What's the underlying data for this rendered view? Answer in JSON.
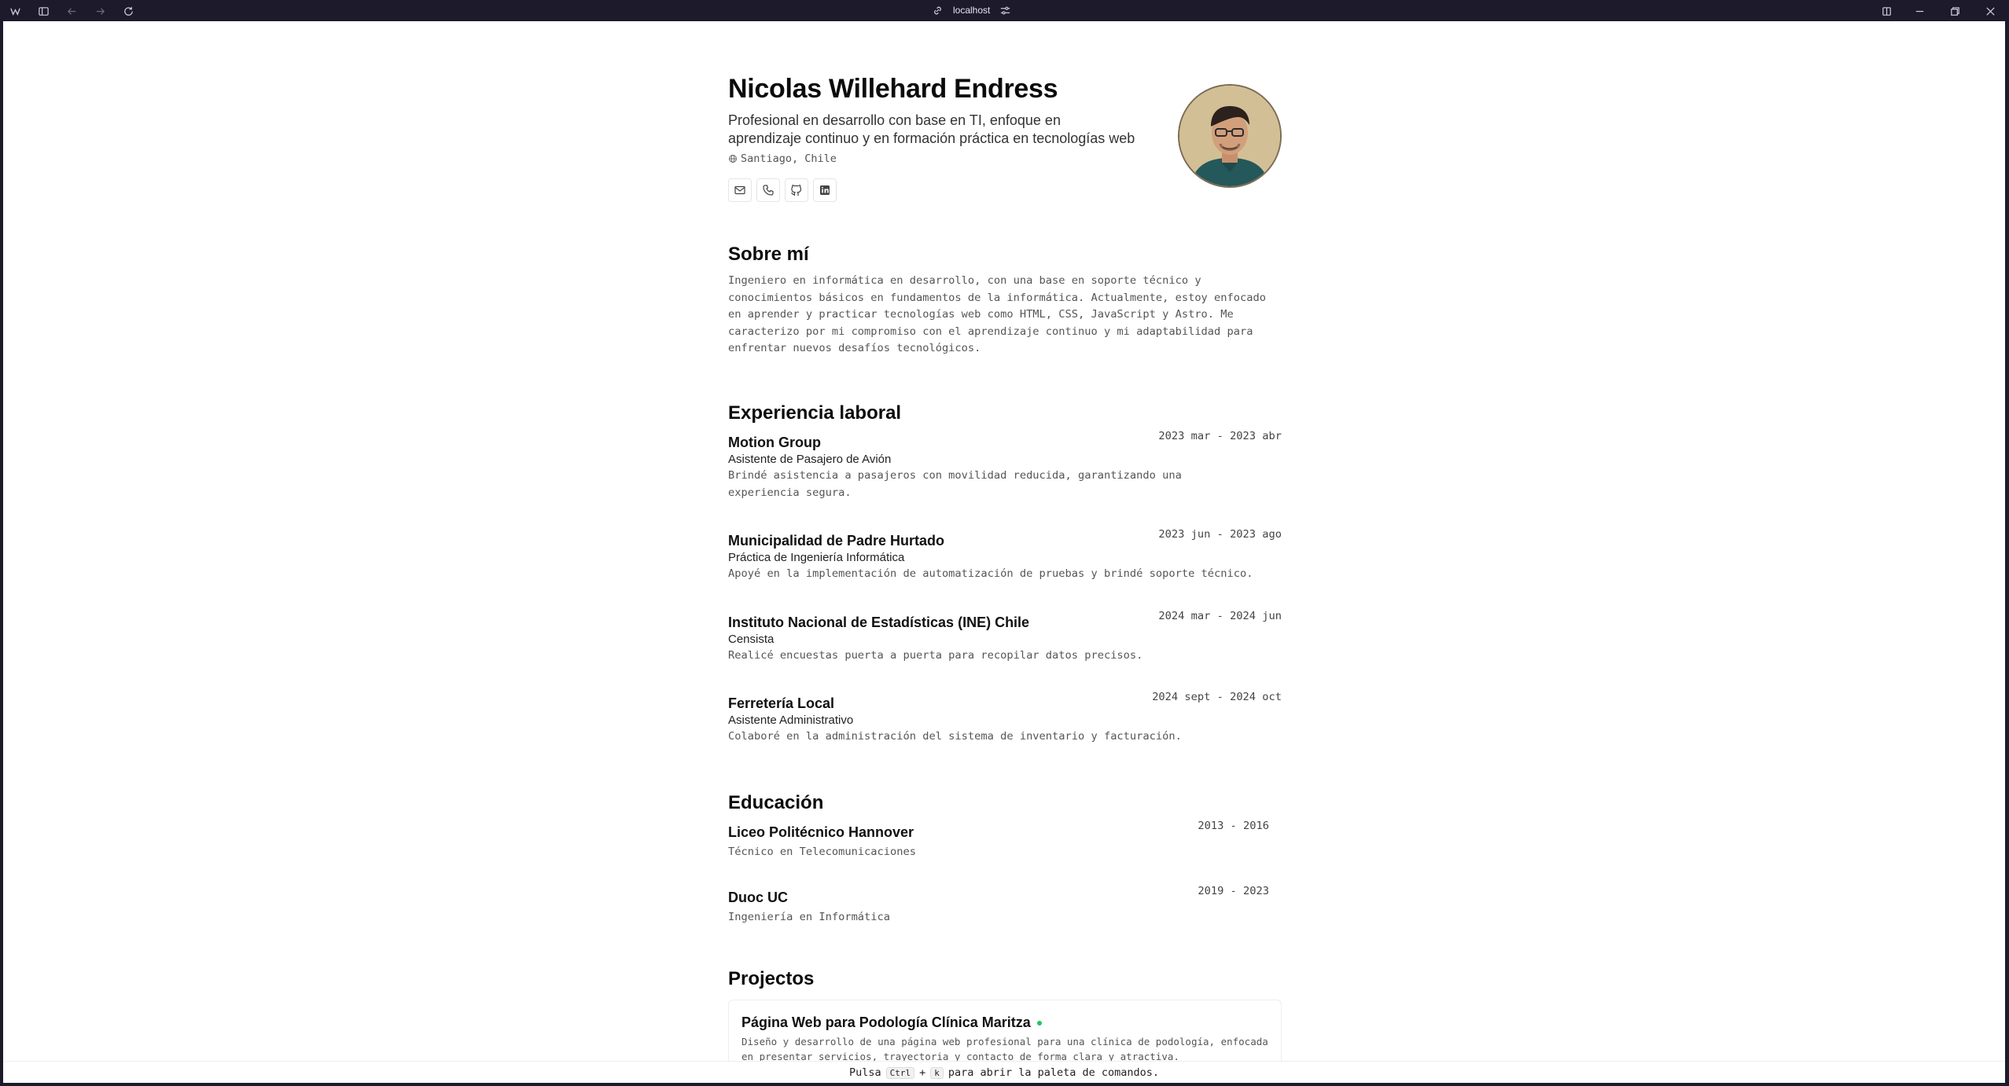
{
  "browser": {
    "address": "localhost",
    "icons": [
      "app-logo-icon",
      "sidebar-toggle-icon",
      "back-arrow-icon",
      "forward-arrow-icon",
      "reload-icon",
      "link-icon",
      "site-settings-icon",
      "split-view-icon",
      "minimize-icon",
      "maximize-icon",
      "close-icon"
    ]
  },
  "profile": {
    "name": "Nicolas Willehard Endress",
    "tagline": "Profesional en desarrollo con base en TI, enfoque en aprendizaje continuo y en formación práctica en tecnologías web",
    "location": "Santiago, Chile",
    "contacts": [
      "mail-icon",
      "phone-icon",
      "github-icon",
      "linkedin-icon"
    ]
  },
  "about": {
    "title": "Sobre mí",
    "text": "Ingeniero en informática en desarrollo, con una base en soporte técnico y conocimientos básicos en fundamentos de la informática. Actualmente, estoy enfocado en aprender y practicar tecnologías web como HTML, CSS, JavaScript y Astro. Me caracterizo por mi compromiso con el aprendizaje continuo y mi adaptabilidad para enfrentar nuevos desafíos tecnológicos."
  },
  "experience": {
    "title": "Experiencia laboral",
    "items": [
      {
        "org": "Motion Group",
        "role": "Asistente de Pasajero de Avión",
        "date": "2023 mar - 2023 abr",
        "desc": "Brindé asistencia a pasajeros con movilidad reducida, garantizando una experiencia segura."
      },
      {
        "org": "Municipalidad de Padre Hurtado",
        "role": "Práctica de Ingeniería Informática",
        "date": "2023 jun - 2023 ago",
        "desc": "Apoyé en la implementación de automatización de pruebas y brindé soporte técnico."
      },
      {
        "org": "Instituto Nacional de Estadísticas (INE) Chile",
        "role": "Censista",
        "date": "2024 mar - 2024 jun",
        "desc": "Realicé encuestas puerta a puerta para recopilar datos precisos."
      },
      {
        "org": "Ferretería Local",
        "role": "Asistente Administrativo",
        "date": "2024 sept - 2024 oct",
        "desc": "Colaboré en la administración del sistema de inventario y facturación."
      }
    ]
  },
  "education": {
    "title": "Educación",
    "items": [
      {
        "school": "Liceo Politécnico Hannover",
        "degree": "Técnico en Telecomunicaciones",
        "date": "2013 - 2016"
      },
      {
        "school": "Duoc UC",
        "degree": "Ingeniería en Informática",
        "date": "2019 - 2023"
      }
    ]
  },
  "projects": {
    "title": "Projectos",
    "items": [
      {
        "title": "Página Web para Podología Clínica Maritza",
        "desc": "Diseño y desarrollo de una página web profesional para una clínica de podología, enfocada en presentar servicios, trayectoria y contacto de forma clara y atractiva."
      }
    ]
  },
  "footer": {
    "prefix": "Pulsa",
    "key1": "Ctrl",
    "plus": "+",
    "key2": "k",
    "suffix": "para abrir la paleta de comandos."
  }
}
